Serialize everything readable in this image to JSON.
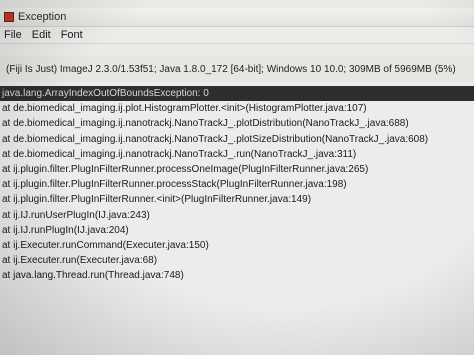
{
  "window": {
    "title": "Exception",
    "menu": [
      "File",
      "Edit",
      "Font"
    ]
  },
  "header": "(Fiji Is Just) ImageJ 2.3.0/1.53f51; Java 1.8.0_172 [64-bit]; Windows 10 10.0; 309MB of 5969MB (5%)",
  "log": {
    "lines": [
      "java.lang.ArrayIndexOutOfBoundsException: 0",
      "at de.biomedical_imaging.ij.plot.HistogramPlotter.<init>(HistogramPlotter.java:107)",
      "at de.biomedical_imaging.ij.nanotrackj.NanoTrackJ_.plotDistribution(NanoTrackJ_.java:688)",
      "at de.biomedical_imaging.ij.nanotrackj.NanoTrackJ_.plotSizeDistribution(NanoTrackJ_.java:608)",
      "at de.biomedical_imaging.ij.nanotrackj.NanoTrackJ_.run(NanoTrackJ_.java:311)",
      "at ij.plugin.filter.PlugInFilterRunner.processOneImage(PlugInFilterRunner.java:265)",
      "at ij.plugin.filter.PlugInFilterRunner.processStack(PlugInFilterRunner.java:198)",
      "at ij.plugin.filter.PlugInFilterRunner.<init>(PlugInFilterRunner.java:149)",
      "at ij.IJ.runUserPlugIn(IJ.java:243)",
      "at ij.IJ.runPlugIn(IJ.java:204)",
      "at ij.Executer.runCommand(Executer.java:150)",
      "at ij.Executer.run(Executer.java:68)",
      "at java.lang.Thread.run(Thread.java:748)"
    ]
  }
}
